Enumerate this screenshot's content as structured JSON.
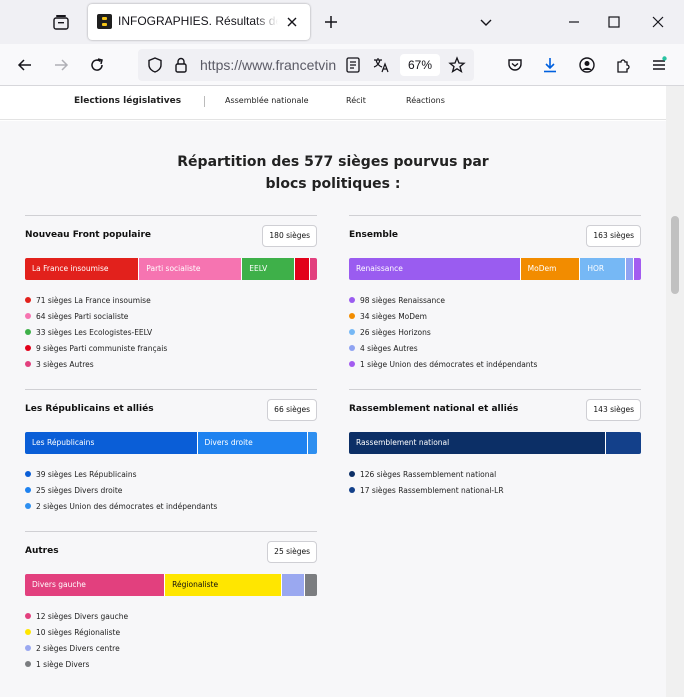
{
  "browser": {
    "tab_title": "INFOGRAPHIES. Résultats des élections législatives",
    "url": "https://www.francetvinfo.fr",
    "zoom": "67%"
  },
  "subnav": {
    "items": [
      "Elections législatives",
      "Assemblée nationale",
      "Récit",
      "Réactions"
    ]
  },
  "main_title_line1": "Répartition des 577 sièges pourvus par",
  "main_title_line2": "blocs politiques :",
  "blocks": [
    {
      "title": "Nouveau Front populaire",
      "seats": "180 sièges",
      "total": 180,
      "parties": [
        {
          "bar_label": "La France insoumise",
          "seats": 71,
          "legend": "71 sièges La France insoumise",
          "color": "#e2211c"
        },
        {
          "bar_label": "Parti socialiste",
          "seats": 64,
          "legend": "64 sièges Parti socialiste",
          "color": "#f674b1"
        },
        {
          "bar_label": "EELV",
          "seats": 33,
          "legend": "33 sièges Les Ecologistes-EELV",
          "color": "#3eb049"
        },
        {
          "bar_label": "",
          "seats": 9,
          "legend": "9 sièges Parti communiste français",
          "color": "#e2011a"
        },
        {
          "bar_label": "",
          "seats": 3,
          "legend": "3 sièges Autres",
          "color": "#e2407e"
        }
      ]
    },
    {
      "title": "Ensemble",
      "seats": "163 sièges",
      "total": 163,
      "parties": [
        {
          "bar_label": "Renaissance",
          "seats": 98,
          "legend": "98 sièges Renaissance",
          "color": "#9a5cf0"
        },
        {
          "bar_label": "MoDem",
          "seats": 34,
          "legend": "34 sièges MoDem",
          "color": "#f28c00"
        },
        {
          "bar_label": "HOR",
          "seats": 26,
          "legend": "26 sièges Horizons",
          "color": "#76b8f5"
        },
        {
          "bar_label": "",
          "seats": 4,
          "legend": "4 sièges Autres",
          "color": "#8fa3f2"
        },
        {
          "bar_label": "",
          "seats": 1,
          "legend": "1 siège Union des démocrates et indépendants",
          "color": "#a35cf0"
        }
      ]
    },
    {
      "title": "Les Républicains et alliés",
      "seats": "66 sièges",
      "total": 66,
      "parties": [
        {
          "bar_label": "Les Républicains",
          "seats": 39,
          "legend": "39 sièges Les Républicains",
          "color": "#0a5ed7"
        },
        {
          "bar_label": "Divers droite",
          "seats": 25,
          "legend": "25 sièges Divers droite",
          "color": "#1e82f0"
        },
        {
          "bar_label": "",
          "seats": 2,
          "legend": "2 sièges Union des démocrates et indépendants",
          "color": "#2e8ff0"
        }
      ]
    },
    {
      "title": "Rassemblement national et alliés",
      "seats": "143 sièges",
      "total": 143,
      "parties": [
        {
          "bar_label": "Rassemblement national",
          "seats": 126,
          "legend": "126 sièges Rassemblement national",
          "color": "#0c2f66"
        },
        {
          "bar_label": "",
          "seats": 17,
          "legend": "17 sièges Rassemblement national-LR",
          "color": "#13408a"
        }
      ]
    },
    {
      "title": "Autres",
      "seats": "25 sièges",
      "total": 25,
      "parties": [
        {
          "bar_label": "Divers gauche",
          "seats": 12,
          "legend": "12 sièges Divers gauche",
          "color": "#e2407e"
        },
        {
          "bar_label": "Régionaliste",
          "seats": 10,
          "legend": "10 sièges Régionaliste",
          "color": "#ffe600"
        },
        {
          "bar_label": "",
          "seats": 2,
          "legend": "2 sièges Divers centre",
          "color": "#9aa8f0"
        },
        {
          "bar_label": "",
          "seats": 1,
          "legend": "1 siège Divers",
          "color": "#7b7d80"
        }
      ]
    }
  ]
}
